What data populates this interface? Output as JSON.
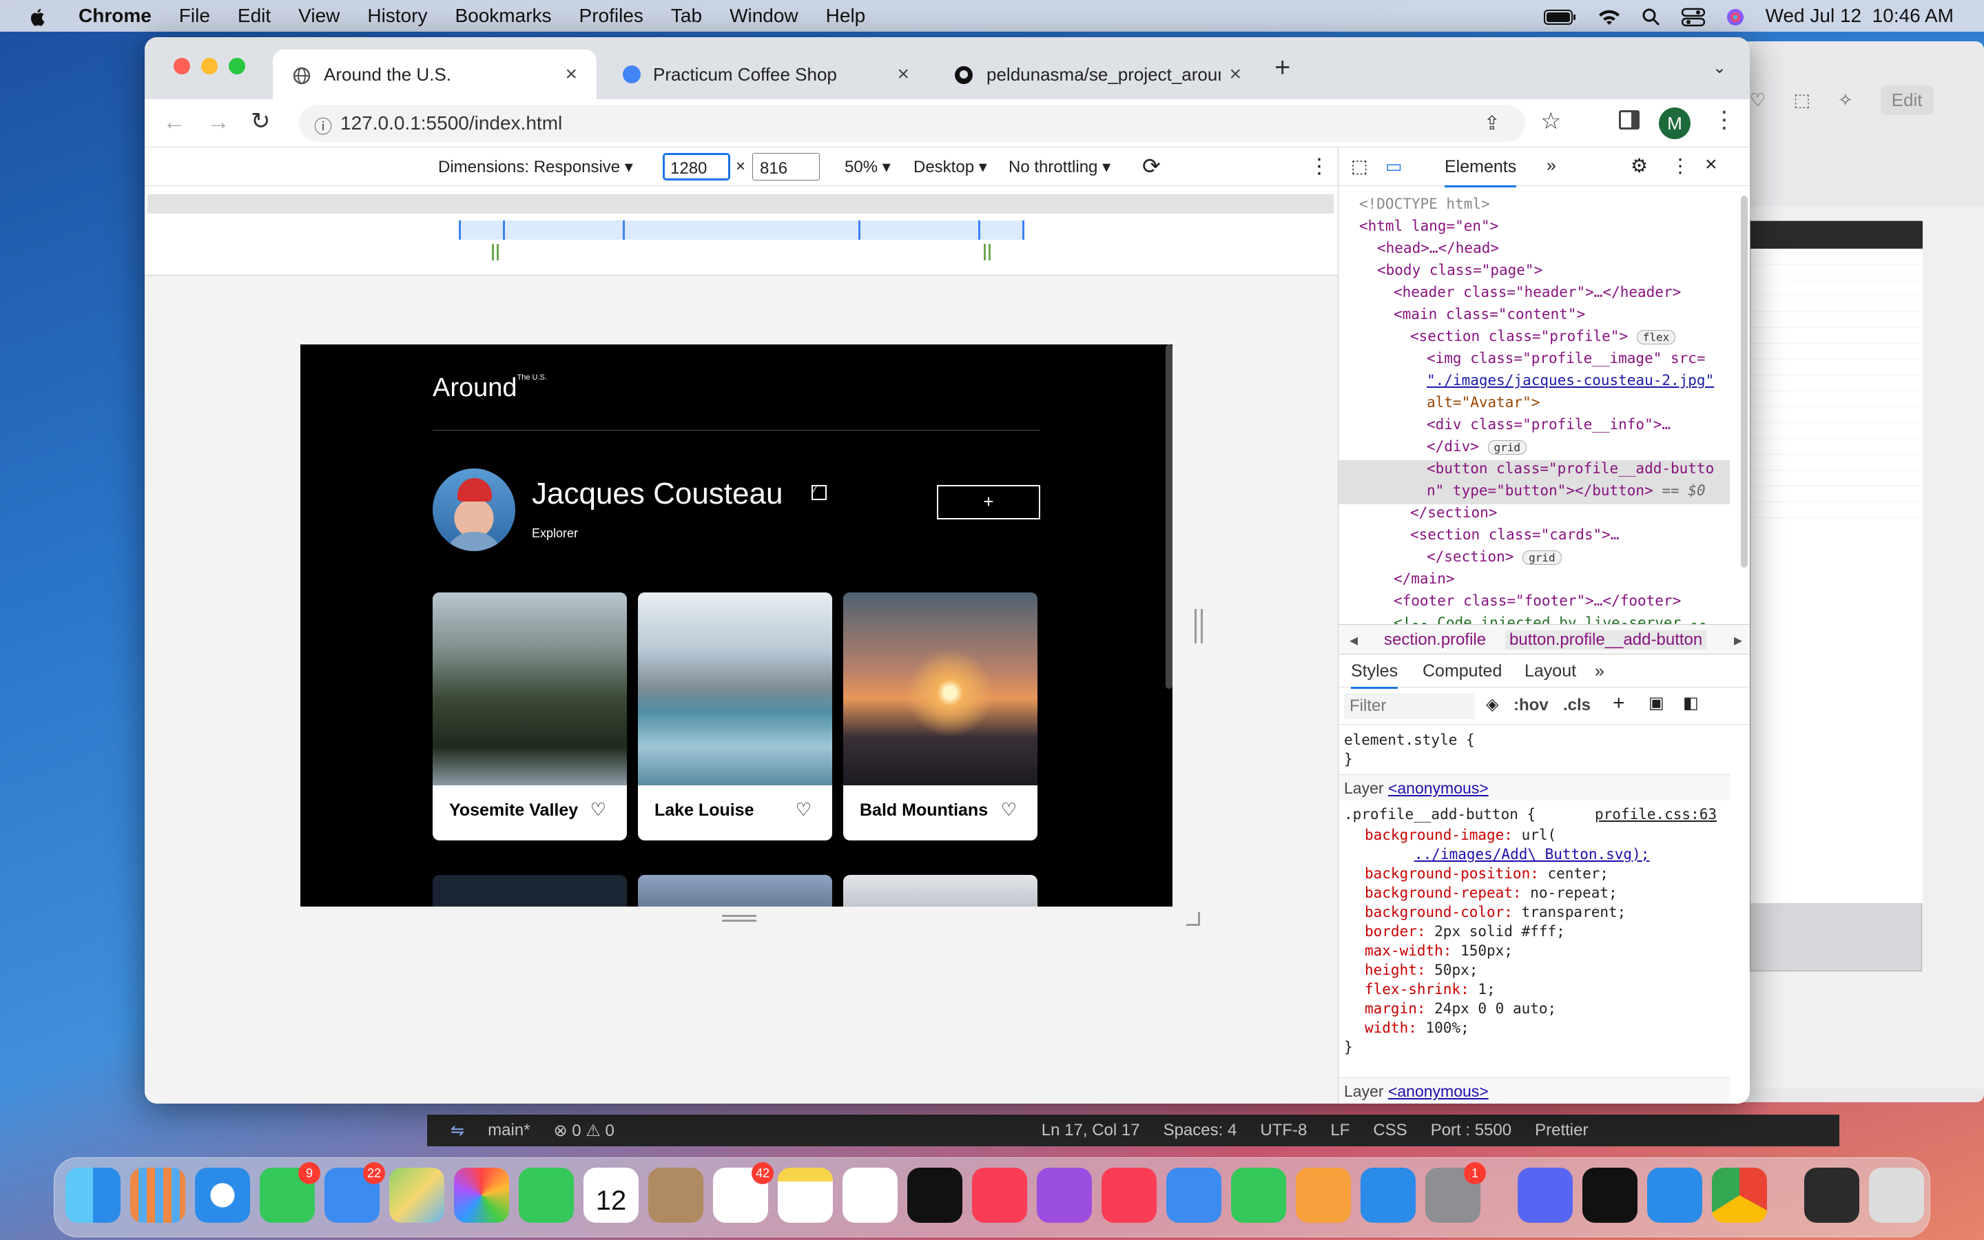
{
  "menubar": {
    "apple_icon": "apple-logo",
    "app": "Chrome",
    "items": [
      "File",
      "Edit",
      "View",
      "History",
      "Bookmarks",
      "Profiles",
      "Tab",
      "Window",
      "Help"
    ],
    "clock": "Wed Jul 12  10:46 AM"
  },
  "chrome": {
    "tabs": [
      {
        "title": "Around the U.S.",
        "icon": "globe-icon",
        "active": true
      },
      {
        "title": "Practicum Coffee Shop",
        "icon": "blue-dot-icon",
        "active": false
      },
      {
        "title": "peldunasma/se_project_aroun",
        "icon": "github-icon",
        "active": false
      }
    ],
    "url": "127.0.0.1:5500/index.html",
    "profile_initial": "M"
  },
  "device_toolbar": {
    "dimensions_label": "Dimensions: Responsive",
    "width": "1280",
    "times": "×",
    "height": "816",
    "zoom": "50%",
    "device_type": "Desktop",
    "throttling": "No throttling"
  },
  "page": {
    "logo": "Around",
    "logo_sup": "The U.S.",
    "profile_name": "Jacques Cousteau",
    "profile_subtitle": "Explorer",
    "add_button": "+",
    "cards": [
      {
        "title": "Yosemite Valley"
      },
      {
        "title": "Lake Louise"
      },
      {
        "title": "Bald Mountians"
      }
    ]
  },
  "devtools": {
    "tabs": [
      "Elements"
    ],
    "elements_tree": [
      "<!DOCTYPE html>",
      "<html lang=\"en\">",
      "<head>…</head>",
      "<body class=\"page\">",
      "<header class=\"header\">…</header>",
      "<main class=\"content\">",
      "<section class=\"profile\">",
      "<img class=\"profile__image\" src=",
      "\"./images/jacques-cousteau-2.jpg\"",
      "alt=\"Avatar\">",
      "<div class=\"profile__info\">…",
      "</div>",
      "<button class=\"profile__add-butto",
      "n\" type=\"button\"></button>",
      "</section>",
      "<section class=\"cards\">…",
      "</section>",
      "</main>",
      "<footer class=\"footer\">…</footer>",
      "<!-- Code injected by live-server --"
    ],
    "badge_flex": "flex",
    "badge_grid": "grid",
    "dollar0": "== $0",
    "breadcrumb": [
      "section.profile",
      "button.profile__add-button"
    ],
    "styles_tabs": [
      "Styles",
      "Computed",
      "Layout"
    ],
    "filter_placeholder": "Filter",
    "filter_tools": [
      ":hov",
      ".cls"
    ],
    "element_style": "element.style {",
    "element_style_close": "}",
    "layer_label": "Layer",
    "layer_link": "<anonymous>",
    "rule_selector": ".profile__add-button {",
    "rule_source": "profile.css:63",
    "rule_props": [
      {
        "p": "background-image",
        "v": "url("
      },
      {
        "p": "",
        "v": "../images/Add\\ Button.svg);"
      },
      {
        "p": "background-position",
        "v": "center;"
      },
      {
        "p": "background-repeat",
        "v": "no-repeat;"
      },
      {
        "p": "background-color",
        "v": "transparent;"
      },
      {
        "p": "border",
        "v": "2px solid  #fff;"
      },
      {
        "p": "max-width",
        "v": "150px;"
      },
      {
        "p": "height",
        "v": "50px;"
      },
      {
        "p": "flex-shrink",
        "v": "1;"
      },
      {
        "p": "margin",
        "v": "24px 0 0 auto;"
      },
      {
        "p": "width",
        "v": "100%;"
      }
    ],
    "rule_close": "}"
  },
  "vscode_status": {
    "branch": "main*",
    "problems": "⊗ 0 ⚠ 0",
    "position": "Ln 17, Col 17",
    "spaces": "Spaces: 4",
    "encoding": "UTF-8",
    "eol": "LF",
    "language": "CSS",
    "port": "Port : 5500",
    "prettier": "Prettier"
  },
  "colors": {
    "accent_blue": "#1a73e8",
    "page_bg": "#000000"
  }
}
